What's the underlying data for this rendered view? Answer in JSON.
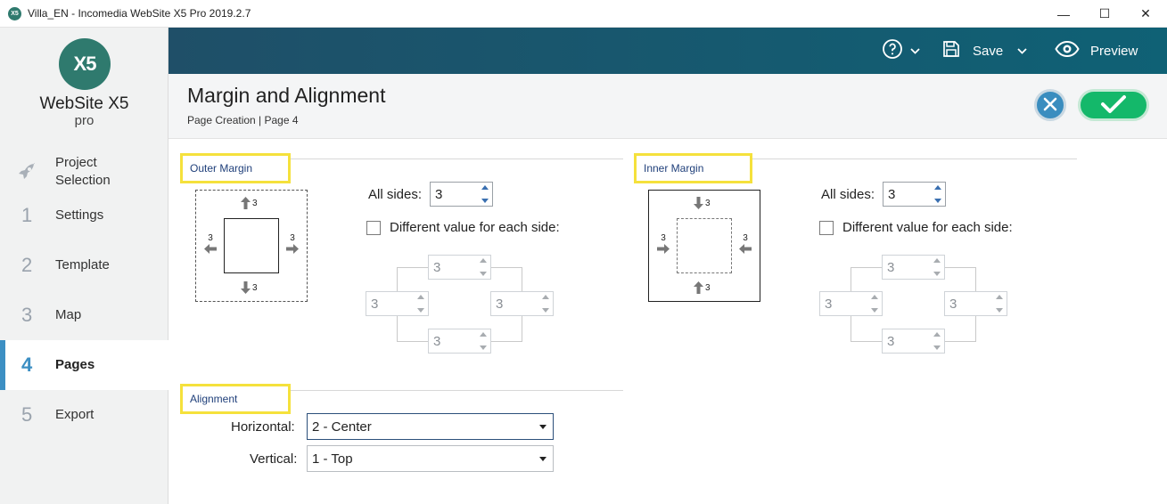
{
  "window": {
    "title": "Villa_EN - Incomedia WebSite X5 Pro 2019.2.7",
    "app_icon": "X5",
    "controls": {
      "minimize": "—",
      "maximize": "☐",
      "close": "✕"
    }
  },
  "logo": {
    "mark": "X5",
    "name": "WebSite X5",
    "edition": "pro"
  },
  "sidebar": {
    "items": [
      {
        "num": "",
        "icon": "rocket-icon",
        "label": "Project Selection",
        "active": false
      },
      {
        "num": "1",
        "label": "Settings",
        "active": false
      },
      {
        "num": "2",
        "label": "Template",
        "active": false
      },
      {
        "num": "3",
        "label": "Map",
        "active": false
      },
      {
        "num": "4",
        "label": "Pages",
        "active": true
      },
      {
        "num": "5",
        "label": "Export",
        "active": false
      }
    ]
  },
  "toolbar": {
    "save_label": "Save",
    "preview_label": "Preview"
  },
  "header": {
    "title": "Margin and Alignment",
    "breadcrumb": "Page Creation | Page 4"
  },
  "outer_margin": {
    "title": "Outer Margin",
    "diagram": {
      "top": "3",
      "bottom": "3",
      "left": "3",
      "right": "3"
    },
    "all_sides_label": "All sides:",
    "all_sides_value": "3",
    "different_label": "Different value for each side:",
    "different_checked": false,
    "sides": {
      "top": "3",
      "left": "3",
      "right": "3",
      "bottom": "3"
    }
  },
  "inner_margin": {
    "title": "Inner Margin",
    "diagram": {
      "top": "3",
      "bottom": "3",
      "left": "3",
      "right": "3"
    },
    "all_sides_label": "All sides:",
    "all_sides_value": "3",
    "different_label": "Different value for each side:",
    "different_checked": false,
    "sides": {
      "top": "3",
      "left": "3",
      "right": "3",
      "bottom": "3"
    }
  },
  "alignment": {
    "title": "Alignment",
    "horizontal_label": "Horizontal:",
    "horizontal_value": "2 - Center",
    "vertical_label": "Vertical:",
    "vertical_value": "1 - Top"
  },
  "colors": {
    "toolbar": "#1f4f68",
    "accent": "#3c8fc3",
    "confirm": "#14b86a",
    "highlight": "#f5e13c"
  }
}
